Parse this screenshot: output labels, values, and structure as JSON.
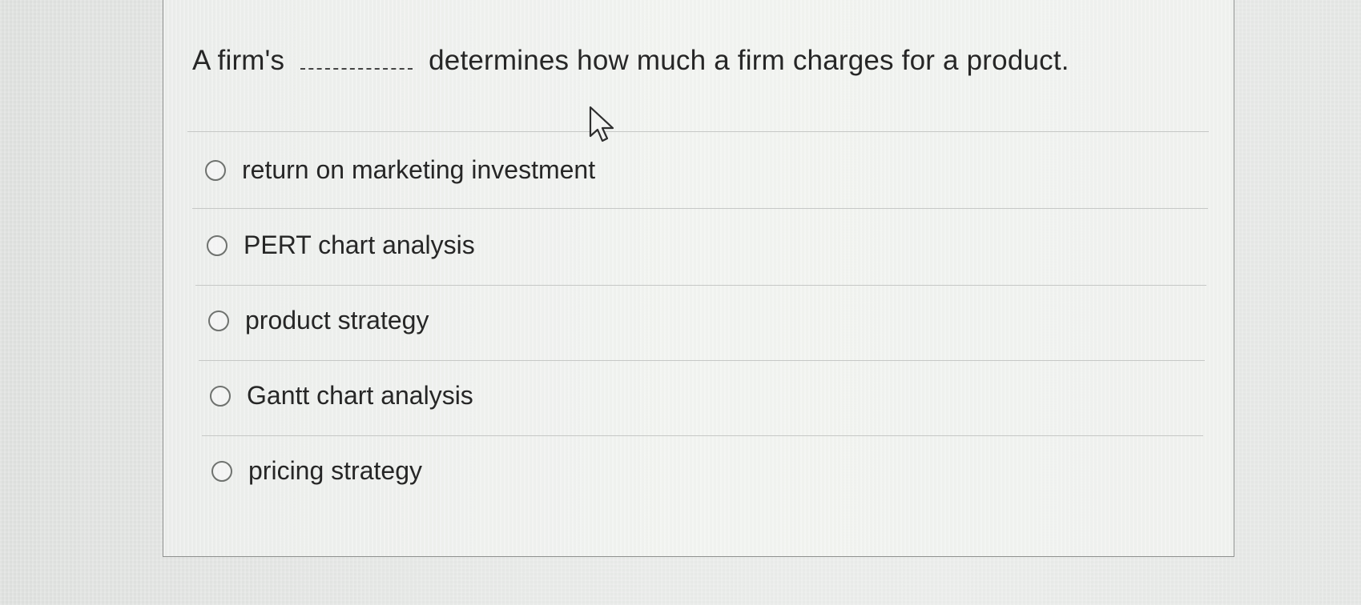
{
  "question": {
    "prefix": "A firm's",
    "suffix": "determines how much a firm charges for a product."
  },
  "options": [
    {
      "label": "return on marketing investment"
    },
    {
      "label": "PERT chart analysis"
    },
    {
      "label": "product strategy"
    },
    {
      "label": "Gantt chart analysis"
    },
    {
      "label": "pricing strategy"
    }
  ],
  "icons": {
    "radio": "radio-unselected-icon",
    "cursor": "mouse-pointer-icon"
  },
  "colors": {
    "border": "#8f918f",
    "text": "#262626",
    "divider": "#c6c8c6"
  }
}
